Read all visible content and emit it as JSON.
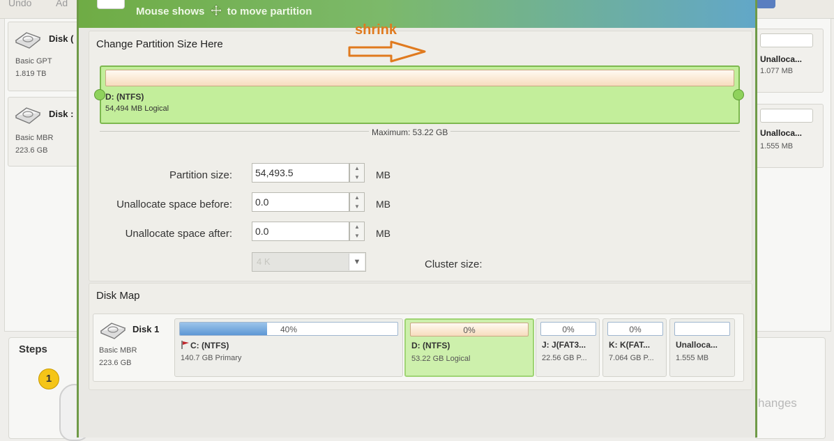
{
  "background": {
    "toolbar": [
      "Undo",
      "Ad"
    ],
    "left_disks": [
      {
        "name": "Disk (",
        "type": "Basic GPT",
        "size": "1.819 TB"
      },
      {
        "name": "Disk :",
        "type": "Basic MBR",
        "size": "223.6 GB"
      }
    ],
    "right_partitions": [
      {
        "label": "Unalloca...",
        "size": "1.077 MB"
      },
      {
        "label": "Unalloca...",
        "size": "1.555 MB"
      }
    ],
    "steps": {
      "title": "Steps",
      "number": "1"
    },
    "changes_text": "hanges"
  },
  "dialog": {
    "hint": {
      "before": "Mouse shows",
      "after": "to move partition"
    },
    "section_title": "Change Partition Size Here",
    "annotation": "shrink",
    "partition": {
      "name": "D: (NTFS)",
      "info": "54,494 MB Logical"
    },
    "maximum": "Maximum: 53.22 GB",
    "form": {
      "partition_size": {
        "label": "Partition size:",
        "value": "54,493.5",
        "unit": "MB"
      },
      "before": {
        "label": "Unallocate space before:",
        "value": "0.0",
        "unit": "MB"
      },
      "after": {
        "label": "Unallocate space after:",
        "value": "0.0",
        "unit": "MB"
      },
      "cluster": {
        "value": "4 K",
        "label": "Cluster size:"
      }
    },
    "disk_map": {
      "title": "Disk Map",
      "disk": {
        "name": "Disk 1",
        "type": "Basic MBR",
        "size": "223.6 GB"
      },
      "partitions": [
        {
          "percent": "40%",
          "used": 0.4,
          "name": "C: (NTFS)",
          "info": "140.7 GB Primary"
        },
        {
          "percent": "0%",
          "used": 0,
          "name": "D: (NTFS)",
          "info": "53.22 GB Logical"
        },
        {
          "percent": "0%",
          "used": 0,
          "name": "J: J(FAT3...",
          "info": "22.56 GB P..."
        },
        {
          "percent": "0%",
          "used": 0,
          "name": "K: K(FAT...",
          "info": "7.064 GB P..."
        },
        {
          "percent": "",
          "used": 0,
          "name": "Unalloca...",
          "info": "1.555 MB"
        }
      ]
    }
  }
}
